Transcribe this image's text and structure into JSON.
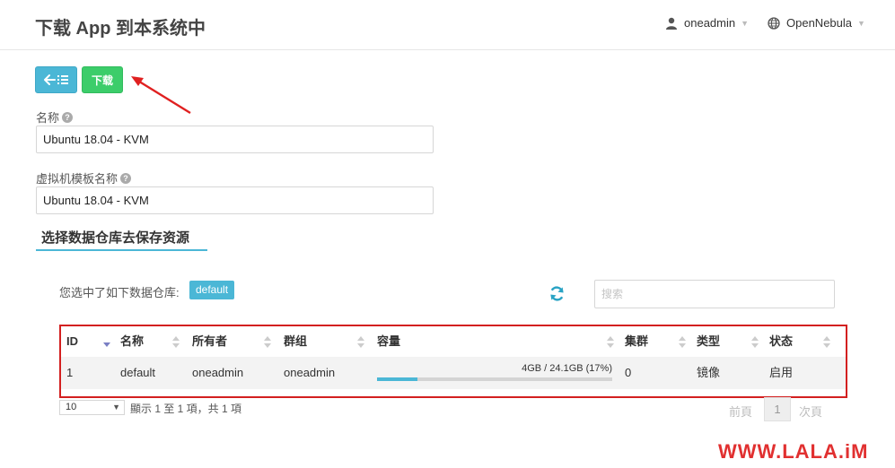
{
  "header": {
    "title": "下载 App 到本系统中",
    "user": "oneadmin",
    "zone": "OpenNebula"
  },
  "toolbar": {
    "back_icon": "back-list-icon",
    "download_label": "下载"
  },
  "form": {
    "name_label": "名称",
    "name_value": "Ubuntu 18.04 - KVM",
    "template_label": "虚拟机模板名称",
    "template_value": "Ubuntu 18.04 - KVM"
  },
  "datastore": {
    "section_title": "选择数据仓库去保存资源",
    "selected_prefix": "您选中了如下数据仓库:",
    "selected_value": "default",
    "search_placeholder": "搜索",
    "columns": [
      "ID",
      "名称",
      "所有者",
      "群组",
      "容量",
      "集群",
      "类型",
      "状态"
    ],
    "rows": [
      {
        "id": "1",
        "name": "default",
        "owner": "oneadmin",
        "group": "oneadmin",
        "capacity": "4GB / 24.1GB (17%)",
        "capacity_fraction": 0.17,
        "cluster": "0",
        "type": "镜像",
        "status": "启用"
      }
    ],
    "page_size": "10",
    "info": "顯示 1 至 1 項，共 1 項",
    "prev": "前頁",
    "page": "1",
    "next": "次頁"
  },
  "watermark": "WWW.LALA.iM",
  "colors": {
    "accent": "#4bb7d6",
    "download": "#3ccd6a",
    "highlight_border": "#d32020"
  }
}
